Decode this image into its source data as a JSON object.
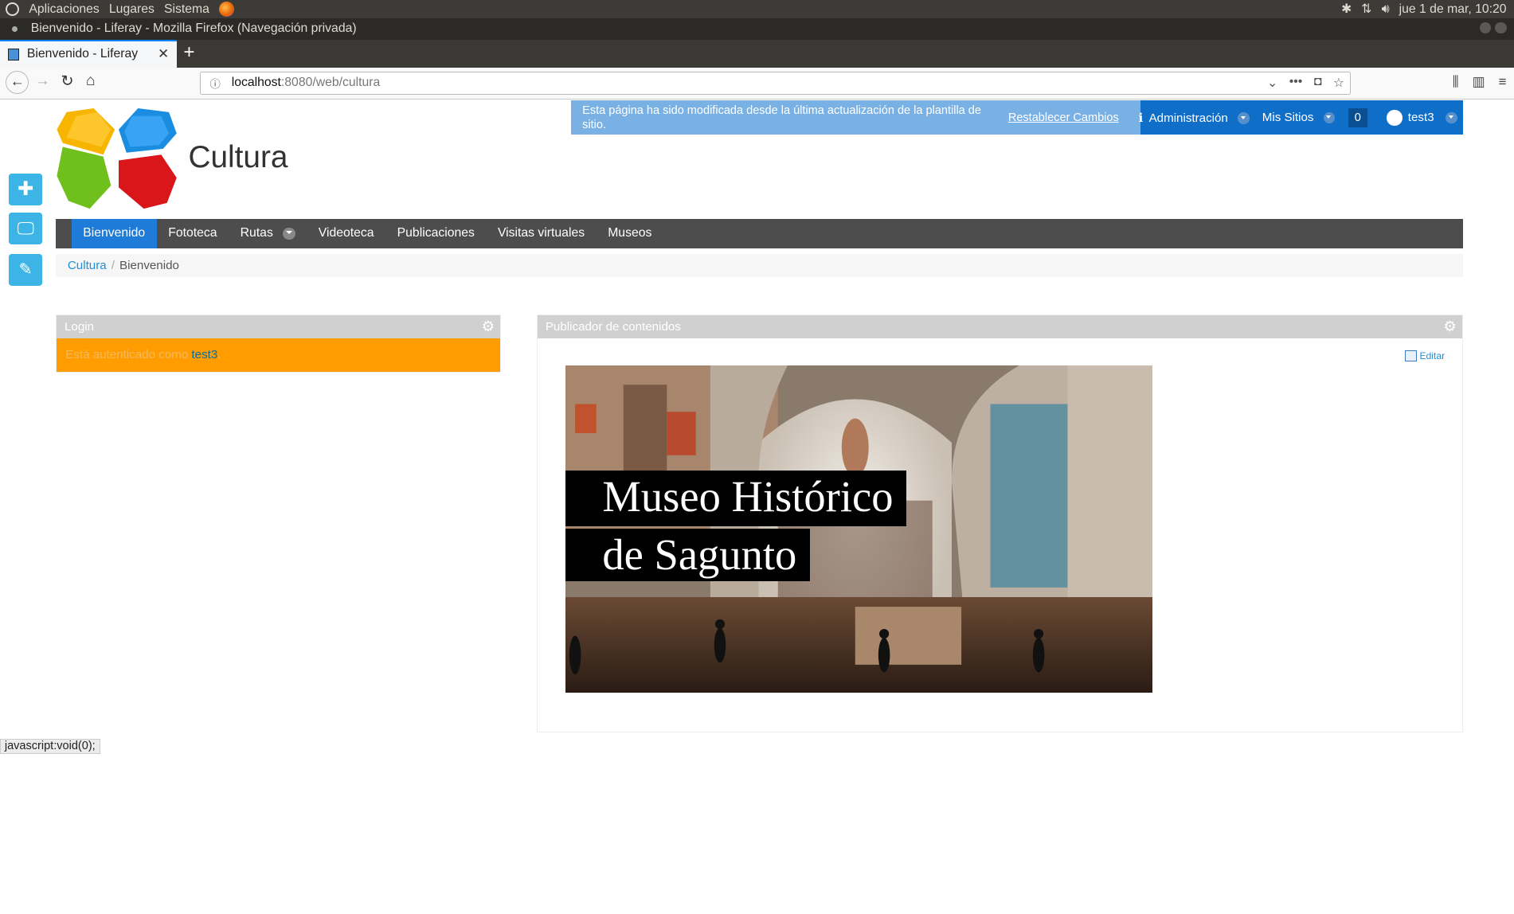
{
  "system": {
    "menu": [
      "Aplicaciones",
      "Lugares",
      "Sistema"
    ],
    "clock": "jue  1 de mar, 10:20"
  },
  "window": {
    "title": "Bienvenido - Liferay - Mozilla Firefox (Navegación privada)"
  },
  "browser": {
    "tab_title": "Bienvenido - Liferay",
    "url_host": "localhost",
    "url_path": ":8080/web/cultura"
  },
  "banner": {
    "message": "Esta página ha sido modificada desde la última actualización de la plantilla de sitio.",
    "reset_label": "Restablecer Cambios"
  },
  "dockbar": {
    "admin_label": "Administración",
    "sites_label": "Mis Sitios",
    "notification_count": "0",
    "user_name": "test3"
  },
  "site": {
    "name": "Cultura"
  },
  "navigation": {
    "items": [
      {
        "label": "Bienvenido",
        "active": true
      },
      {
        "label": "Fototeca"
      },
      {
        "label": "Rutas",
        "has_dropdown": true
      },
      {
        "label": "Videoteca"
      },
      {
        "label": "Publicaciones"
      },
      {
        "label": "Visitas virtuales"
      },
      {
        "label": "Museos"
      }
    ]
  },
  "breadcrumb": {
    "root": "Cultura",
    "current": "Bienvenido"
  },
  "login_portlet": {
    "title": "Login",
    "message": "Está autenticado como ",
    "user": "test3",
    "suffix": "."
  },
  "content_portlet": {
    "title": "Publicador de contenidos",
    "edit_label": "Editar",
    "image_title_line1": "Museo Histórico",
    "image_title_line2": "de Sagunto"
  },
  "status_bar": {
    "text": "javascript:void(0);"
  },
  "colors": {
    "nav_bg": "#4d4d4d",
    "nav_active": "#1e7bd8",
    "dockbar": "#0f6ec8",
    "banner": "#7ab1e5",
    "login_bg": "#ff9d00",
    "side_buttons": "#3cb4e5"
  }
}
